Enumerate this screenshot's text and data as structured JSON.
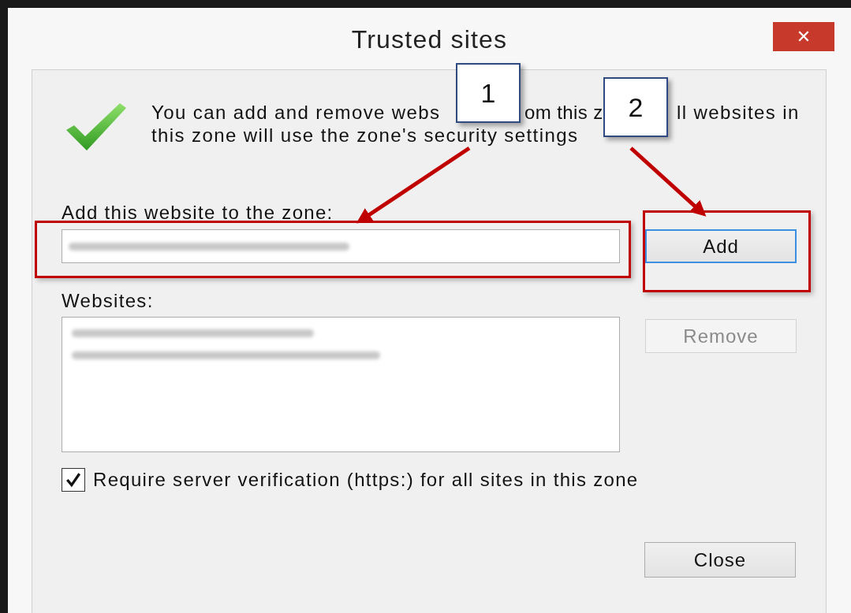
{
  "window": {
    "title": "Trusted sites",
    "close_symbol": "✕"
  },
  "intro_lines": [
    [
      "You can add and remove webs",
      "om this z",
      "ll websites in"
    ],
    [
      "this zone will use the zone's security settings"
    ]
  ],
  "add_field": {
    "label": "Add this website to the zone:",
    "value_blurred": true
  },
  "add_button": {
    "label": "Add",
    "disabled": false,
    "focused": true
  },
  "websites": {
    "label": "Websites:",
    "items": [
      {
        "blurred": true
      },
      {
        "blurred": true
      }
    ]
  },
  "remove_button": {
    "label": "Remove",
    "disabled": true
  },
  "require_verification": {
    "label": "Require server verification (https:) for all sites in this zone",
    "checked": true
  },
  "close_button": {
    "label": "Close"
  },
  "annotations": [
    {
      "label": "1"
    },
    {
      "label": "2"
    }
  ]
}
